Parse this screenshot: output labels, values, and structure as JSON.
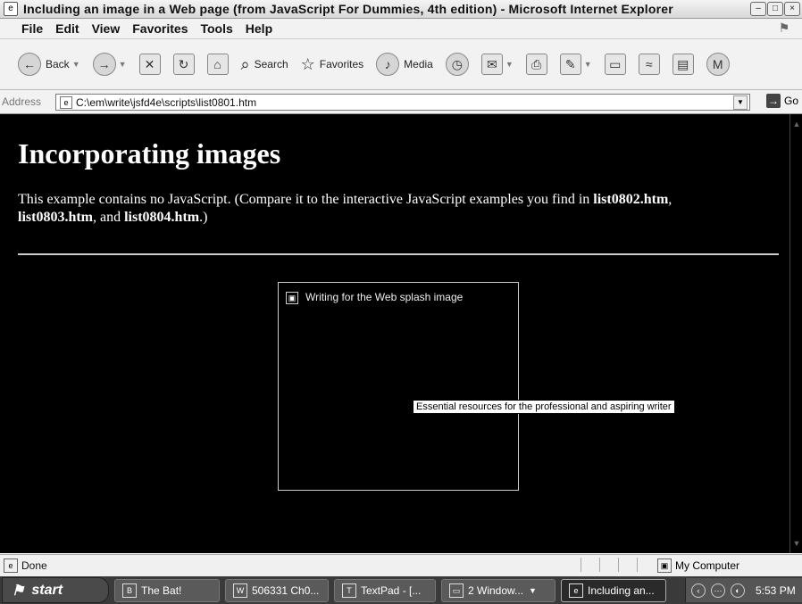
{
  "window": {
    "title": "Including an image in a Web page (from JavaScript For Dummies, 4th edition) - Microsoft Internet Explorer"
  },
  "menu": [
    "File",
    "Edit",
    "View",
    "Favorites",
    "Tools",
    "Help"
  ],
  "toolbar": {
    "back": "Back",
    "search": "Search",
    "favorites": "Favorites",
    "media": "Media"
  },
  "address": {
    "label": "Address",
    "value": "C:\\em\\write\\jsfd4e\\scripts\\list0801.htm",
    "go": "Go"
  },
  "page": {
    "heading": "Incorporating images",
    "para_prefix": "This example contains no JavaScript. (Compare it to the interactive JavaScript examples you find in ",
    "link1": "list0802.htm",
    "comma": ",",
    "link2": "list0803.htm",
    "and": ", and ",
    "link3": "list0804.htm",
    "para_suffix": ".)",
    "image_alt": "Writing for the Web splash image",
    "tooltip": "Essential resources for the professional and aspiring writer"
  },
  "status": {
    "text": "Done",
    "zone": "My Computer"
  },
  "taskbar": {
    "start": "start",
    "tasks": [
      "The Bat!",
      "506331 Ch0...",
      "TextPad - [...",
      "2 Window...",
      "Including an..."
    ],
    "clock": "5:53 PM"
  }
}
